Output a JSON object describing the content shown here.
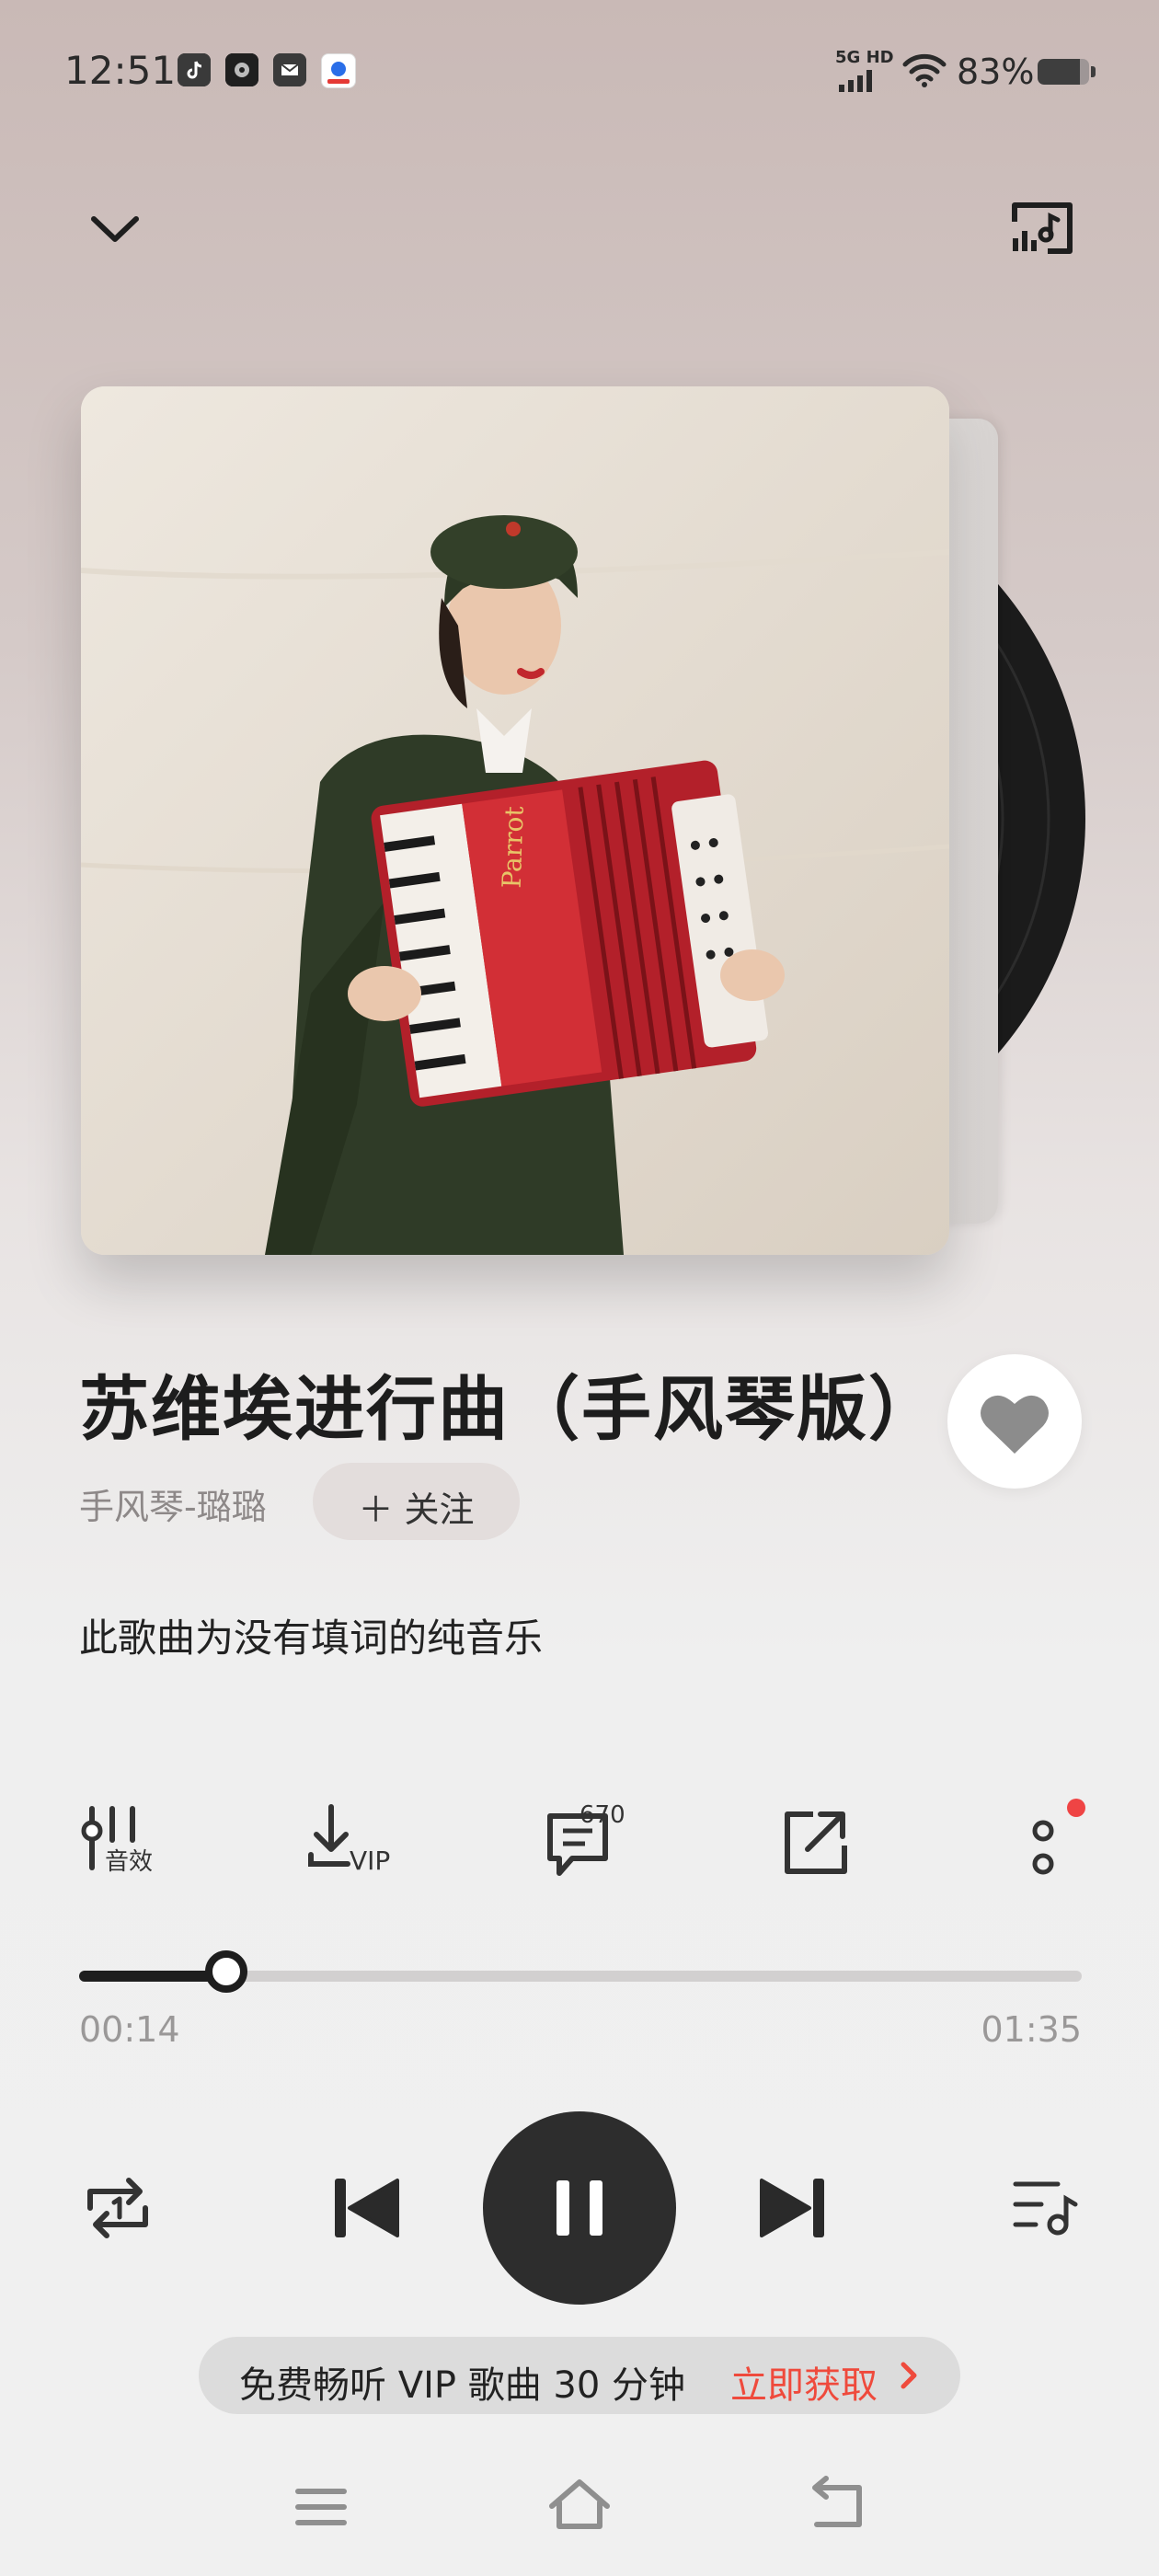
{
  "status_bar": {
    "time": "12:51",
    "network": "5G HD",
    "battery_percent": "83%",
    "battery_level": 0.83,
    "app_icons": [
      "tiktok-icon",
      "app-icon",
      "mail-icon",
      "baidu-icon"
    ]
  },
  "header": {
    "collapse_icon": "chevron-down-icon",
    "cast_icon": "cast-music-icon"
  },
  "song": {
    "title": "苏维埃进行曲（手风琴版）",
    "artist": "手风琴-璐璐",
    "follow_label": "＋ 关注",
    "lyrics_note": "此歌曲为没有填词的纯音乐",
    "liked": false
  },
  "actions": {
    "sound_effect_label": "音效",
    "download_label": "VIP",
    "comment_count": "670",
    "share_icon": "share-icon",
    "more_icon": "more-vertical-icon",
    "more_has_badge": true
  },
  "progress": {
    "elapsed": "00:14",
    "total": "01:35",
    "fraction": 0.147
  },
  "controls": {
    "mode_icon": "repeat-one-icon",
    "prev_icon": "skip-previous-icon",
    "play_state_icon": "pause-icon",
    "next_icon": "skip-next-icon",
    "playlist_icon": "playlist-icon"
  },
  "vip_banner": {
    "text": "免费畅听 VIP 歌曲 30 分钟",
    "action": "立即获取"
  },
  "nav_bar": {
    "menu_icon": "menu-icon",
    "home_icon": "home-icon",
    "back_icon": "back-icon"
  },
  "colors": {
    "accent_red": "#ef4a3c",
    "dark": "#1e1e1e",
    "play_button": "#2d2d2d"
  }
}
